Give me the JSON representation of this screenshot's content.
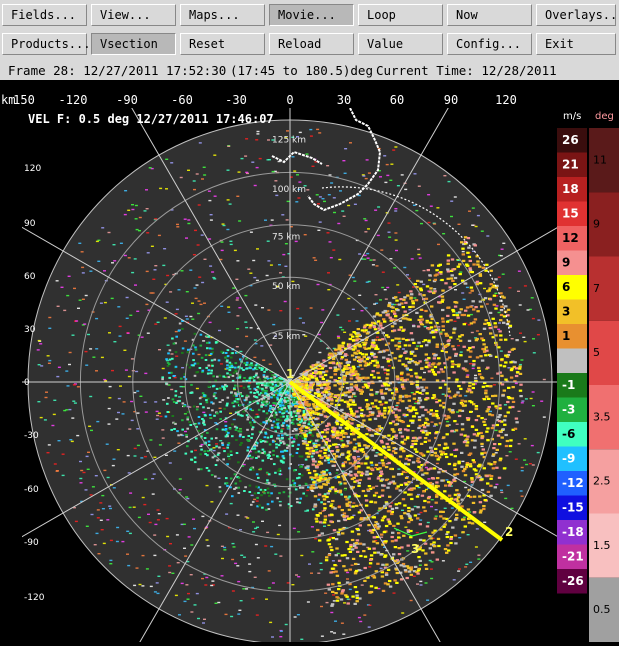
{
  "toolbar": {
    "buttons": [
      {
        "label": "Fields...",
        "name": "fields-button"
      },
      {
        "label": "View...",
        "name": "view-button"
      },
      {
        "label": "Maps...",
        "name": "maps-button"
      },
      {
        "label": "Movie...",
        "name": "movie-button"
      },
      {
        "label": "Loop",
        "name": "loop-button"
      },
      {
        "label": "Now",
        "name": "now-button"
      },
      {
        "label": "Overlays...",
        "name": "overlays-button"
      },
      {
        "label": "Products...",
        "name": "products-button"
      },
      {
        "label": "Vsection",
        "name": "vsection-button"
      },
      {
        "label": "Reset",
        "name": "reset-button"
      },
      {
        "label": "Reload",
        "name": "reload-button"
      },
      {
        "label": "Value",
        "name": "value-button"
      },
      {
        "label": "Config...",
        "name": "config-button"
      },
      {
        "label": "Exit",
        "name": "exit-button"
      }
    ],
    "pressed": [
      "Movie...",
      "Vsection"
    ]
  },
  "frame": {
    "frame_text": "Frame 28: 12/27/2011 17:52:30",
    "range_text": "(17:45 to 180.5)deg",
    "current_time": "Current Time: 12/28/2011 05:04:20"
  },
  "axis": {
    "unit": "km",
    "x_ticks": [
      "150",
      "-120",
      "-90",
      "-60",
      "-30",
      "0",
      "30",
      "60",
      "90",
      "120"
    ],
    "y_ticks": [
      "120",
      "90",
      "60",
      "30",
      "0",
      "-30",
      "-60",
      "-90",
      "-120"
    ]
  },
  "plot": {
    "product_label": "VEL  F: 0.5 deg 12/27/2011 17:46:07",
    "range_ring_labels": [
      "125 km",
      "100 km",
      "75 km",
      "50 km",
      "25 km"
    ],
    "markers": [
      "1",
      "2",
      "3"
    ],
    "colors": {
      "background": "#303030",
      "rings": "#9a9a9a",
      "cross_line": "#ffff00",
      "map": "#ffffff"
    }
  },
  "legend": {
    "left_unit": "m/s",
    "right_unit": "deg",
    "velocity": [
      {
        "label": "26",
        "color": "#3a0d0d"
      },
      {
        "label": "21",
        "color": "#7a1414"
      },
      {
        "label": "18",
        "color": "#b82020"
      },
      {
        "label": "15",
        "color": "#e03232"
      },
      {
        "label": "12",
        "color": "#f06262"
      },
      {
        "label": "9",
        "color": "#f59090"
      },
      {
        "label": "6",
        "color": "#ffff00"
      },
      {
        "label": "3",
        "color": "#f2c028"
      },
      {
        "label": "1",
        "color": "#e89030"
      },
      {
        "label": "",
        "color": "#c0c0c0"
      },
      {
        "label": "-1",
        "color": "#1a7a1a"
      },
      {
        "label": "-3",
        "color": "#20b040"
      },
      {
        "label": "-6",
        "color": "#40ffc0"
      },
      {
        "label": "-9",
        "color": "#20c0ff"
      },
      {
        "label": "-12",
        "color": "#2060ff"
      },
      {
        "label": "-15",
        "color": "#1010e0"
      },
      {
        "label": "-18",
        "color": "#9030d0"
      },
      {
        "label": "-21",
        "color": "#c030a0"
      },
      {
        "label": "-26",
        "color": "#600040"
      }
    ],
    "phase": [
      {
        "label": "11",
        "color": "#5a1a1a"
      },
      {
        "label": "9",
        "color": "#8a2020"
      },
      {
        "label": "7",
        "color": "#b83030"
      },
      {
        "label": "5",
        "color": "#e04848"
      },
      {
        "label": "3.5",
        "color": "#f07070"
      },
      {
        "label": "2.5",
        "color": "#f5a0a0"
      },
      {
        "label": "1.5",
        "color": "#f8c0c0"
      },
      {
        "label": "0.5",
        "color": "#a0a0a0"
      }
    ]
  }
}
